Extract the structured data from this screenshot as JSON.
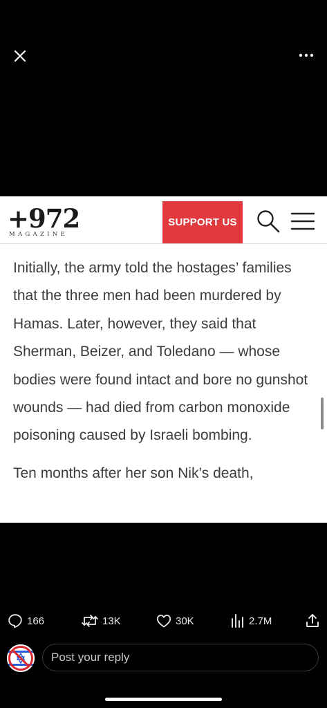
{
  "viewer": {
    "close_icon": "close-icon",
    "more_icon": "more-horizontal-icon"
  },
  "site": {
    "logo_main": "+972",
    "logo_sub": "MAGAZINE",
    "support_label": "SUPPORT US",
    "accent_color": "#e0393e",
    "search_icon": "search-icon",
    "menu_icon": "menu-icon"
  },
  "article": {
    "paragraphs": [
      "Initially, the army told the hostages’ families that the three men had been murdered by Hamas. Later, however, they said that Sherman, Beizer, and Toledano — whose bodies were found intact and bore no gunshot wounds — had died from carbon monoxide poisoning caused by Israeli bombing.",
      "Ten months after her son Nik’s death,"
    ]
  },
  "actions": {
    "replies": "166",
    "reposts": "13K",
    "likes": "30K",
    "views": "2.7M"
  },
  "reply": {
    "placeholder": "Post your reply"
  }
}
